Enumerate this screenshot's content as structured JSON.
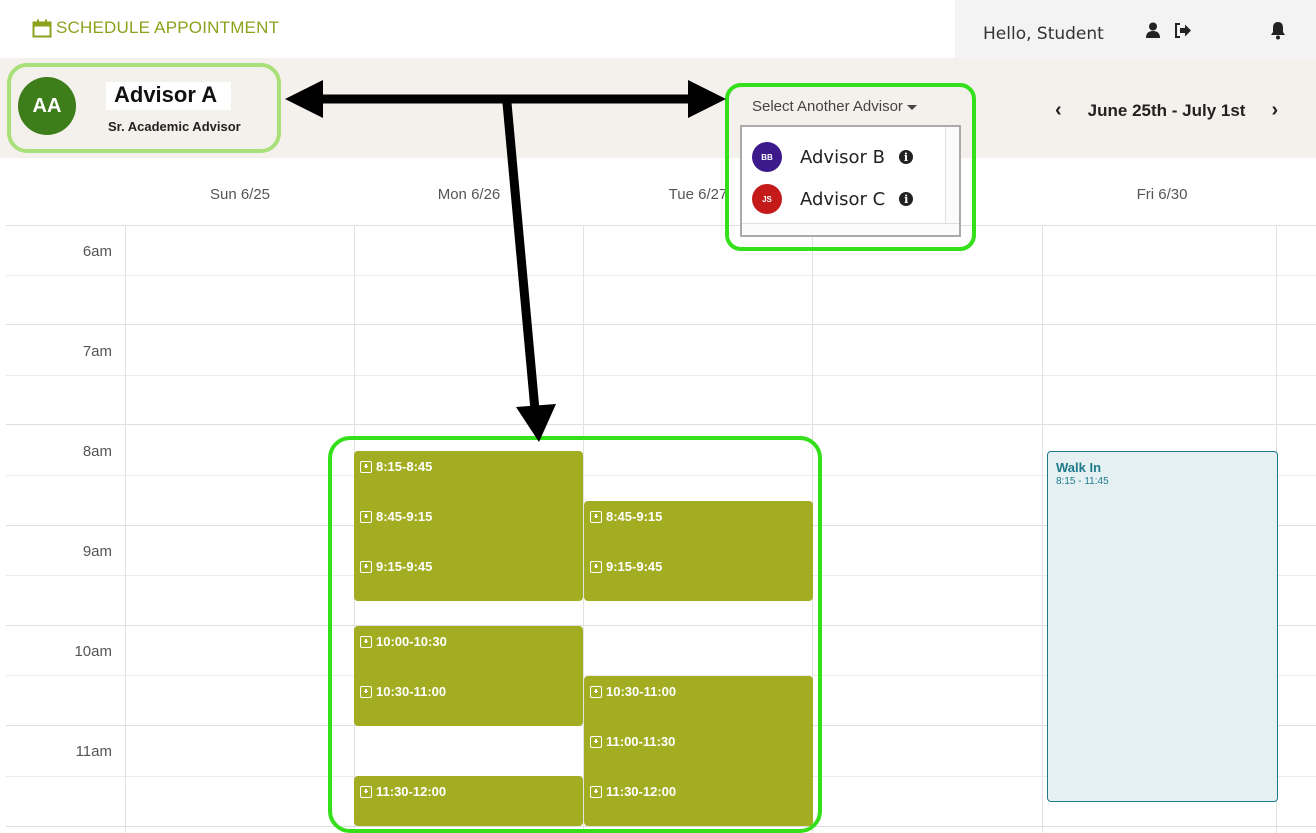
{
  "header": {
    "app_title": "SCHEDULE APPOINTMENT",
    "greeting": "Hello, Student",
    "icons": [
      "calendar-icon",
      "user-icon",
      "sign-out-icon",
      "bell-icon"
    ]
  },
  "advisor": {
    "initials": "AA",
    "name": "Advisor A",
    "role": "Sr. Academic Advisor"
  },
  "advisor_select": {
    "label": "Select Another Advisor",
    "options": [
      {
        "initials": "BB",
        "name": "Advisor B",
        "color": "#3c1a8c"
      },
      {
        "initials": "JS",
        "name": "Advisor C",
        "color": "#c41a1a"
      }
    ]
  },
  "week": {
    "label": "June 25th - July 1st"
  },
  "days": [
    "Sun 6/25",
    "Mon 6/26",
    "Tue 6/27",
    "Fri 6/30"
  ],
  "times": [
    "6am",
    "7am",
    "8am",
    "9am",
    "10am",
    "11am"
  ],
  "slots": {
    "mon": [
      "8:15-8:45",
      "8:45-9:15",
      "9:15-9:45",
      "10:00-10:30",
      "10:30-11:00",
      "11:30-12:00"
    ],
    "tue": [
      "8:45-9:15",
      "9:15-9:45",
      "10:30-11:00",
      "11:00-11:30",
      "11:30-12:00"
    ]
  },
  "walk_in": {
    "title": "Walk In",
    "time": "8:15 - 11:45"
  },
  "colors": {
    "accent": "#8aa21c",
    "slot": "#a3ad22",
    "highlight": "#33e01a",
    "walkin": "#1e7a8a"
  }
}
